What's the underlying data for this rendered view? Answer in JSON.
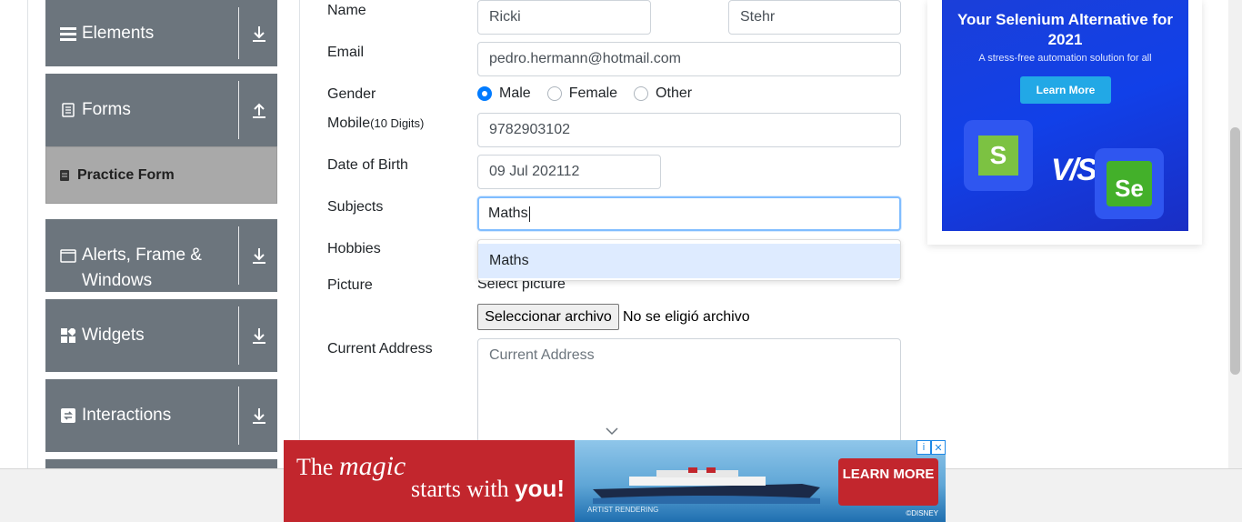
{
  "sidebar": {
    "groups": [
      {
        "label": "Elements",
        "icon": "hamburger-icon",
        "arrow": "download-icon"
      },
      {
        "label": "Forms",
        "icon": "document-icon",
        "arrow": "upload-icon"
      },
      {
        "label": "Alerts, Frame & Windows",
        "icon": "window-icon",
        "arrow": "download-icon"
      },
      {
        "label": "Widgets",
        "icon": "widgets-icon",
        "arrow": "download-icon"
      },
      {
        "label": "Interactions",
        "icon": "interactions-icon",
        "arrow": "download-icon"
      }
    ],
    "active_item": "Practice Form"
  },
  "form": {
    "name_label": "Name",
    "first_name": "Ricki",
    "last_name": "Stehr",
    "email_label": "Email",
    "email": "pedro.hermann@hotmail.com",
    "gender_label": "Gender",
    "gender_options": [
      "Male",
      "Female",
      "Other"
    ],
    "gender_selected": "Male",
    "mobile_label": "Mobile",
    "mobile_hint": "(10 Digits)",
    "mobile": "9782903102",
    "dob_label": "Date of Birth",
    "dob": "09 Jul 202112",
    "subjects_label": "Subjects",
    "subjects_value": "Maths",
    "subjects_suggestion": "Maths",
    "hobbies_label": "Hobbies",
    "picture_label": "Picture",
    "picture_select": "Select picture",
    "file_button": "Seleccionar archivo",
    "file_status": "No se eligió archivo",
    "address_label": "Current Address",
    "address_placeholder": "Current Address"
  },
  "ad_right": {
    "title": "Your Selenium Alternative for 2021",
    "subtitle": "A stress-free automation solution for all",
    "button": "Learn More",
    "vs": "V/S",
    "se_logo": "Se"
  },
  "ad_bottom": {
    "line1_a": "The",
    "line1_b": "magic",
    "line2_a": "starts with",
    "line2_b": "you!",
    "button": "LEARN MORE",
    "note": "ARTIST RENDERING",
    "brand": "©DISNEY"
  },
  "colors": {
    "sidebar_bg": "#6c757d",
    "active_item_bg": "#a9a9a9",
    "focus_border": "#80bdff",
    "radio_checked": "#007bff",
    "suggestion_bg": "#deebff",
    "ad_blue": "#1140e8",
    "ad_red": "#c2262d"
  }
}
